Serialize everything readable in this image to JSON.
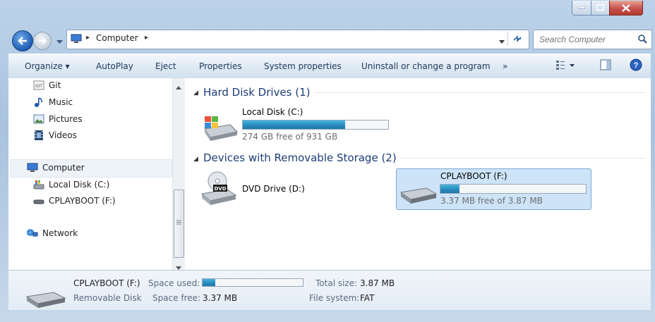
{
  "address": {
    "root": "Computer"
  },
  "search": {
    "placeholder": "Search Computer"
  },
  "toolbar": {
    "organize": "Organize",
    "autoplay": "AutoPlay",
    "eject": "Eject",
    "properties": "Properties",
    "system_properties": "System properties",
    "uninstall": "Uninstall or change a program",
    "more": "»"
  },
  "sidebar": {
    "items": [
      {
        "label": "Git",
        "icon": "git-folder-icon"
      },
      {
        "label": "Music",
        "icon": "music-icon"
      },
      {
        "label": "Pictures",
        "icon": "pictures-icon"
      },
      {
        "label": "Videos",
        "icon": "videos-icon"
      },
      {
        "label": "Computer",
        "icon": "computer-icon"
      },
      {
        "label": "Local Disk (C:)",
        "icon": "local-disk-icon"
      },
      {
        "label": "CPLAYBOOT (F:)",
        "icon": "removable-drive-icon"
      },
      {
        "label": "Network",
        "icon": "network-icon"
      }
    ]
  },
  "main": {
    "groups": [
      {
        "title": "Hard Disk Drives (1)"
      },
      {
        "title": "Devices with Removable Storage (2)"
      }
    ],
    "drives": [
      {
        "name": "Local Disk (C:)",
        "free_text": "274 GB free of 931 GB",
        "used_fraction": 0.706
      },
      {
        "name": "DVD Drive (D:)"
      },
      {
        "name": "CPLAYBOOT (F:)",
        "free_text": "3.37 MB free of 3.87 MB",
        "used_fraction": 0.13
      }
    ]
  },
  "details": {
    "name": "CPLAYBOOT (F:)",
    "type": "Removable Disk",
    "space_used_label": "Space used:",
    "space_used_fraction": 0.13,
    "space_free_label": "Space free:",
    "space_free_value": "3.37 MB",
    "total_size_label": "Total size:",
    "total_size_value": "3.87 MB",
    "file_system_label": "File system:",
    "file_system_value": "FAT"
  },
  "colors": {
    "accent": "#2a8cbf",
    "selection": "#cde3f7"
  }
}
